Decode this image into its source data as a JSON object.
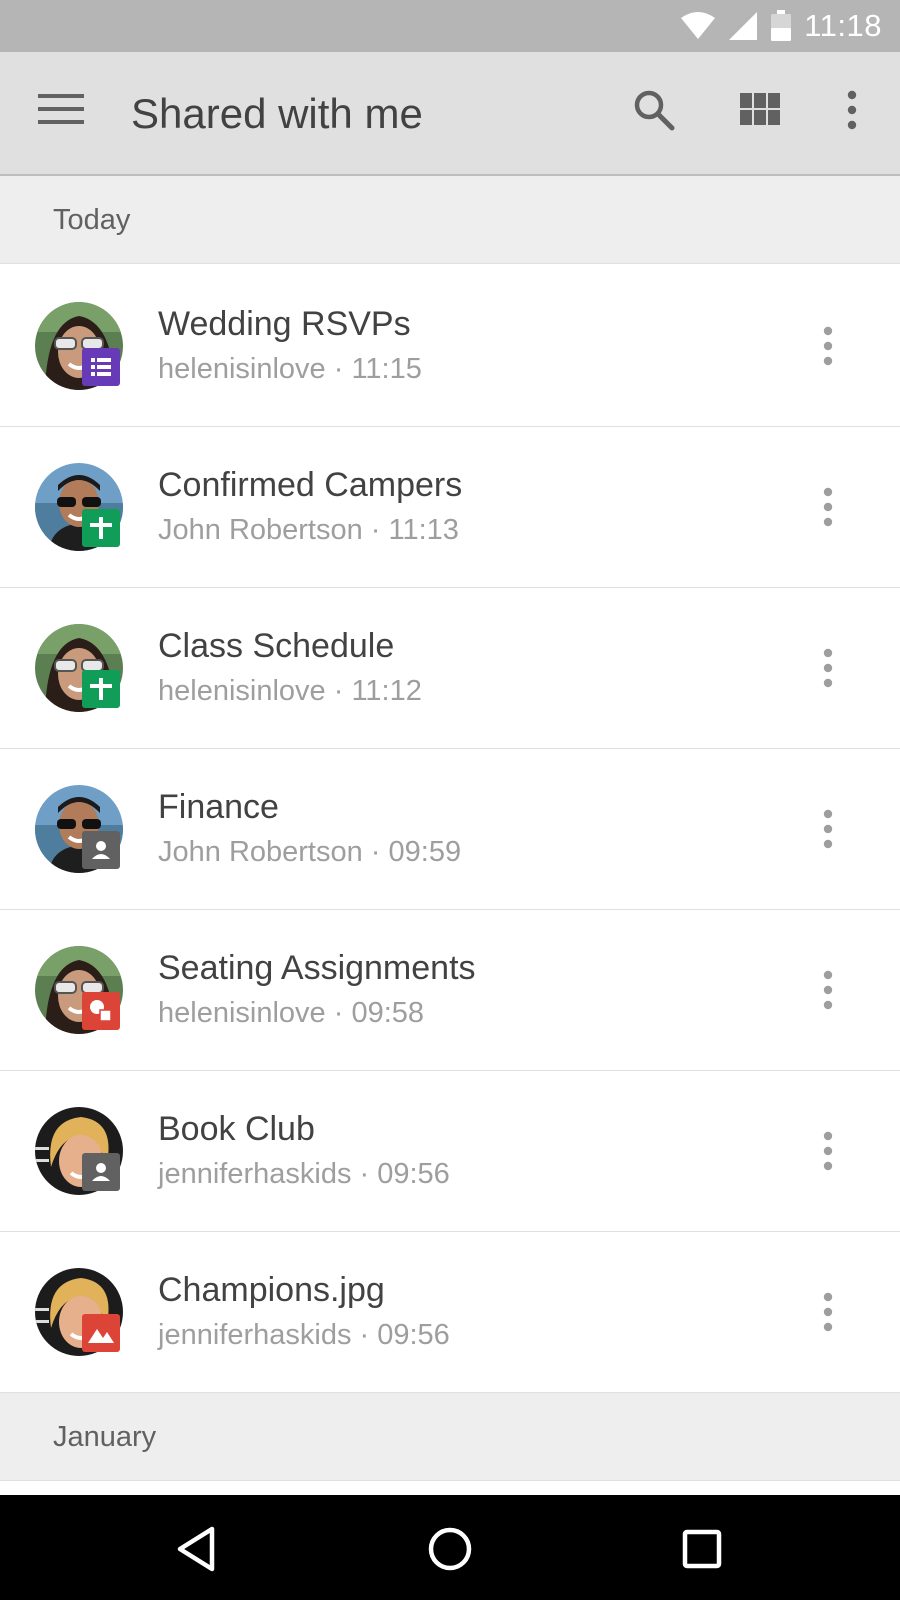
{
  "status_bar": {
    "time": "11:18",
    "icons": [
      "wifi-icon",
      "cell-signal-icon",
      "battery-icon"
    ]
  },
  "app_bar": {
    "title": "Shared with me",
    "menu_icon": "hamburger-menu-icon",
    "actions": [
      "search-icon",
      "grid-view-icon",
      "more-vert-icon"
    ]
  },
  "sections": [
    {
      "label": "Today",
      "items": [
        {
          "title": "Wedding RSVPs",
          "subtitle": "helenisinlove · 11:15",
          "avatar": "helen",
          "file_type": "form-icon",
          "badge_color": "#673ab7"
        },
        {
          "title": "Confirmed Campers",
          "subtitle": "John Robertson · 11:13",
          "avatar": "john",
          "file_type": "spreadsheet-icon",
          "badge_color": "#0f9d58"
        },
        {
          "title": "Class Schedule",
          "subtitle": "helenisinlove · 11:12",
          "avatar": "helen",
          "file_type": "spreadsheet-icon",
          "badge_color": "#0f9d58"
        },
        {
          "title": "Finance",
          "subtitle": "John Robertson · 09:59",
          "avatar": "john",
          "file_type": "shared-folder-icon",
          "badge_color": "#616161"
        },
        {
          "title": "Seating Assignments",
          "subtitle": "helenisinlove · 09:58",
          "avatar": "helen",
          "file_type": "drawing-icon",
          "badge_color": "#db4437"
        },
        {
          "title": "Book Club",
          "subtitle": "jenniferhaskids · 09:56",
          "avatar": "jennifer",
          "file_type": "shared-folder-icon",
          "badge_color": "#616161"
        },
        {
          "title": "Champions.jpg",
          "subtitle": "jenniferhaskids · 09:56",
          "avatar": "jennifer",
          "file_type": "image-icon",
          "badge_color": "#db4437"
        }
      ]
    },
    {
      "label": "January",
      "items": []
    }
  ],
  "nav_bar": {
    "buttons": [
      "back-icon",
      "home-icon",
      "recents-icon"
    ]
  }
}
